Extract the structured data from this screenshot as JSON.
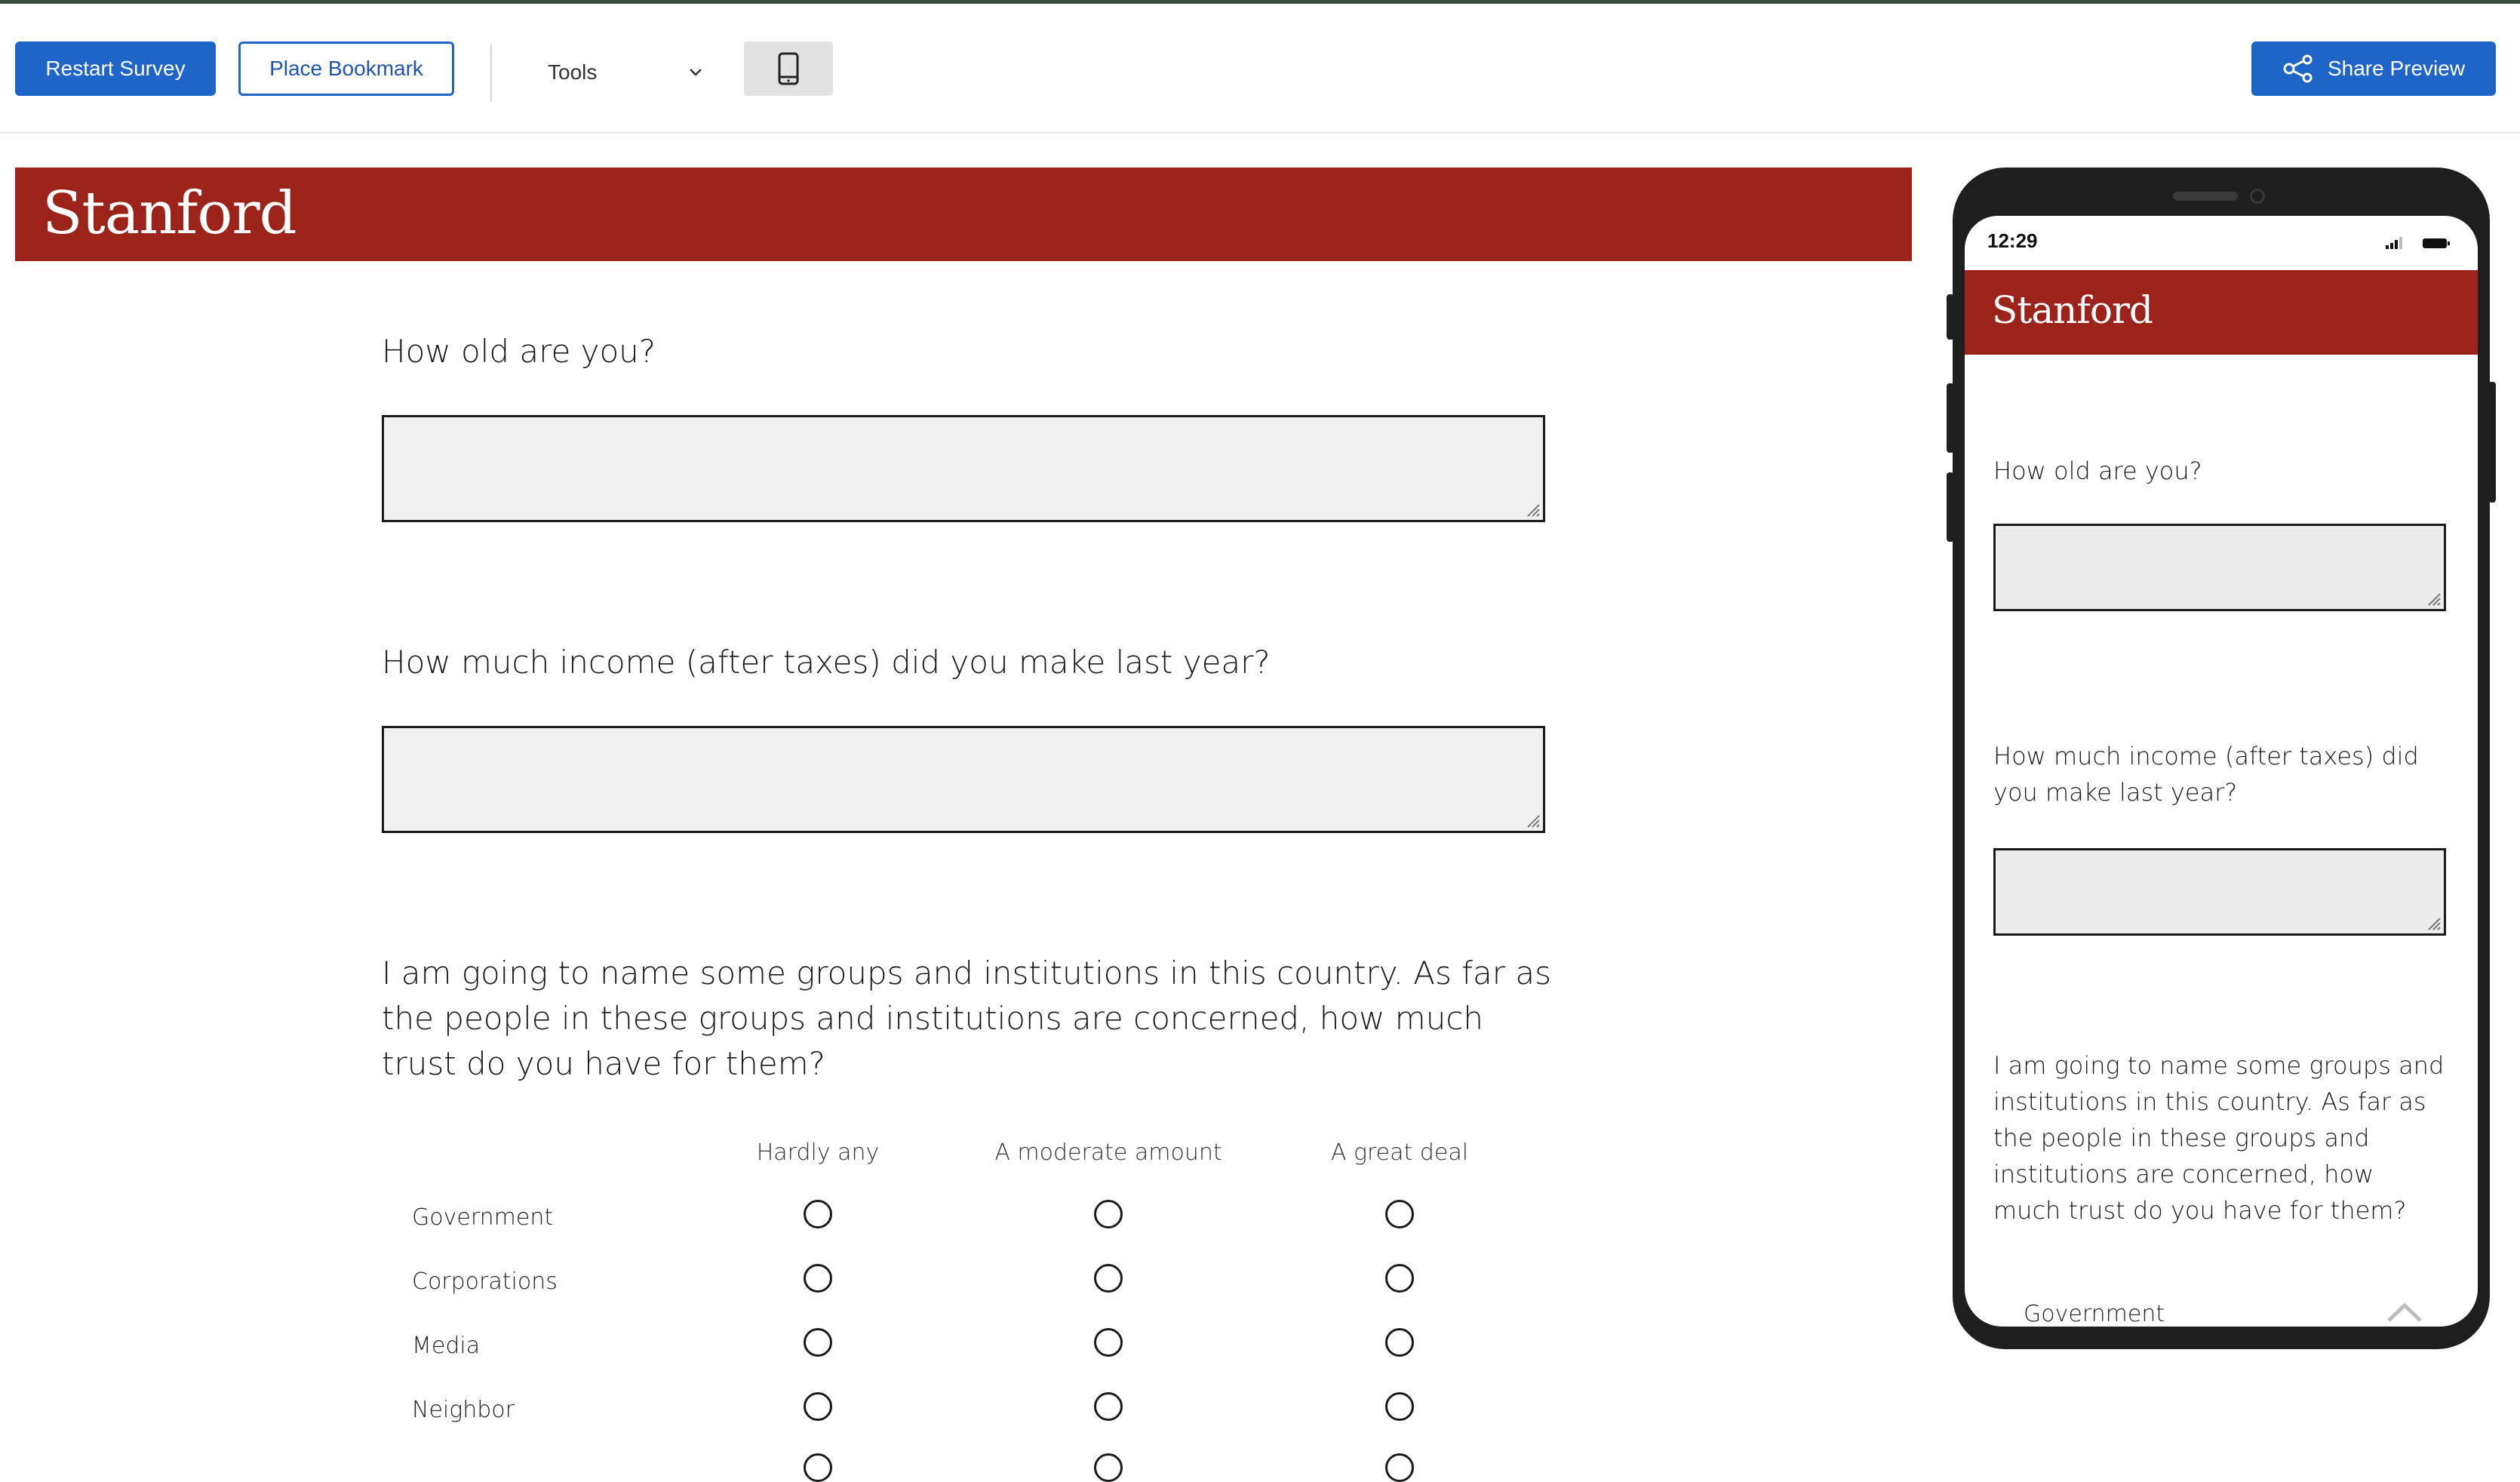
{
  "toolbar": {
    "restart_label": "Restart Survey",
    "bookmark_label": "Place Bookmark",
    "tools_label": "Tools",
    "share_label": "Share Preview",
    "device_icon": "mobile-phone-icon",
    "share_icon": "share-nodes-icon"
  },
  "survey": {
    "brand": "Stanford",
    "brand_color": "#9c2319",
    "q1": "How old are you?",
    "q1_value": "",
    "q2": "How much income (after taxes) did you make last year?",
    "q2_value": "",
    "q3": "I am going to name some groups and institutions in this country. As far as the people in these groups and institutions are concerned, how much trust do you have for them?",
    "columns": [
      "Hardly any",
      "A moderate amount",
      "A great deal"
    ],
    "rows": [
      "Government",
      "Corporations",
      "Media",
      "Neighbor"
    ]
  },
  "mobile": {
    "time": "12:29",
    "brand": "Stanford",
    "q1": "How old are you?",
    "q2": "How much income (after taxes) did you make last year?",
    "q3": "I am going to name some groups and institutions in this country. As far as the people in these groups and institutions are concerned, how much trust do you have for them?",
    "first_row": "Government"
  },
  "colors": {
    "primary": "#1f65c8",
    "banner": "#9c2319"
  }
}
